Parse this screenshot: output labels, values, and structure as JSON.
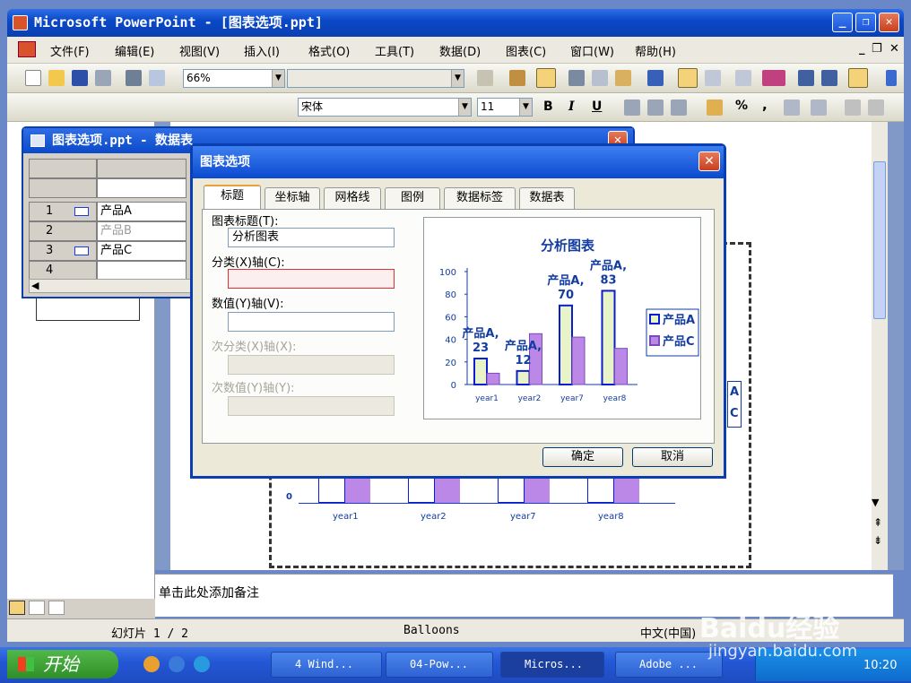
{
  "window": {
    "title": "Microsoft PowerPoint - [图表选项.ppt]"
  },
  "menu": [
    "文件(F)",
    "编辑(E)",
    "视图(V)",
    "插入(I)",
    "格式(O)",
    "工具(T)",
    "数据(D)",
    "图表(C)",
    "窗口(W)",
    "帮助(H)"
  ],
  "toolbar": {
    "zoom": "66%",
    "font_name": "宋体",
    "font_size": "11",
    "bold": "B",
    "italic": "I",
    "underline": "U",
    "percent": "%",
    "comma": ","
  },
  "datasheet": {
    "title": "图表选项.ppt - 数据表",
    "rows": [
      {
        "num": "1",
        "label": "产品A",
        "enabled": true
      },
      {
        "num": "2",
        "label": "产品B",
        "enabled": false
      },
      {
        "num": "3",
        "label": "产品C",
        "enabled": true
      },
      {
        "num": "4",
        "label": "",
        "enabled": true
      }
    ]
  },
  "dialog": {
    "title": "图表选项",
    "tabs": [
      "标题",
      "坐标轴",
      "网格线",
      "图例",
      "数据标签",
      "数据表"
    ],
    "active_tab": 0,
    "fields": [
      {
        "label": "图表标题(T):",
        "value": "分析图表",
        "enabled": true
      },
      {
        "label": "分类(X)轴(C):",
        "value": "",
        "enabled": true
      },
      {
        "label": "数值(Y)轴(V):",
        "value": "",
        "enabled": true
      },
      {
        "label": "次分类(X)轴(X):",
        "value": "",
        "enabled": false
      },
      {
        "label": "次数值(Y)轴(Y):",
        "value": "",
        "enabled": false
      }
    ],
    "ok": "确定",
    "cancel": "取消"
  },
  "chart_data": {
    "type": "bar",
    "title": "分析图表",
    "categories": [
      "year1",
      "year2",
      "year7",
      "year8"
    ],
    "ylim": [
      0,
      100
    ],
    "yticks": [
      "100",
      "80",
      "60",
      "40",
      "20",
      "0"
    ],
    "series": [
      {
        "name": "产品A",
        "values": [
          23,
          12,
          70,
          83
        ],
        "color": "#e8f4c8",
        "stroke": "#0a1ed0"
      },
      {
        "name": "产品C",
        "values": [
          10,
          45,
          42,
          32
        ],
        "color": "#bb88e8",
        "stroke": "#7a4ab8"
      }
    ],
    "data_label_prefix": "产品A,",
    "legend": "right"
  },
  "background_chart": {
    "categories": [
      "year1",
      "year2",
      "year7",
      "year8"
    ],
    "tick": "10",
    "tick_zero": "0"
  },
  "notes": {
    "placeholder": "单击此处添加备注"
  },
  "status": {
    "slide": "幻灯片 1 / 2",
    "design": "Balloons",
    "language": "中文(中国)"
  },
  "taskbar": {
    "start": "开始",
    "tasks": [
      "4 Wind...",
      "04-Pow...",
      "Micros...",
      "Adobe ..."
    ],
    "clock": "10:20"
  },
  "watermark": {
    "brand": "Baidu经验",
    "url": "jingyan.baidu.com"
  }
}
